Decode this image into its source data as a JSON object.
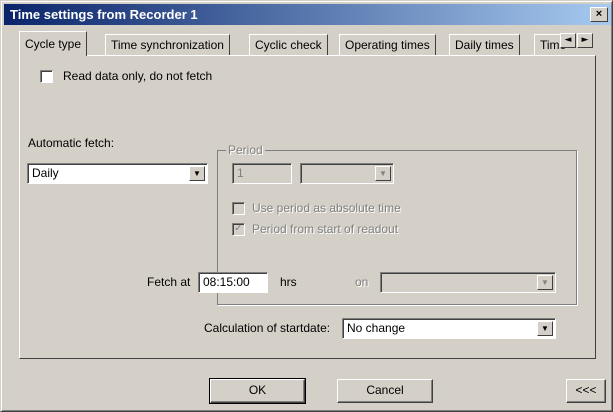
{
  "window": {
    "title": "Time settings from Recorder 1",
    "close_glyph": "×"
  },
  "tabs": [
    {
      "label": "Cycle type",
      "active": true
    },
    {
      "label": "Time synchronization"
    },
    {
      "label": "Cyclic check"
    },
    {
      "label": "Operating times"
    },
    {
      "label": "Daily times"
    },
    {
      "label": "Time"
    }
  ],
  "tab_scroll": {
    "left": "◄",
    "right": "►"
  },
  "read_only": {
    "label": "Read data only, do not fetch",
    "checked": false
  },
  "automatic_fetch": {
    "label": "Automatic fetch:",
    "value": "Daily"
  },
  "period": {
    "label": "Period",
    "count_value": "1",
    "unit_value": "",
    "absolute_time": {
      "label": "Use period as absolute time",
      "checked": false
    },
    "from_start": {
      "label": "Period from start of readout",
      "checked": true,
      "check_glyph": "✓"
    }
  },
  "fetch_at": {
    "label": "Fetch at",
    "value": "08:15:00",
    "unit": "hrs",
    "on_label": "on",
    "on_value": ""
  },
  "startdate": {
    "label": "Calculation of startdate:",
    "value": "No change"
  },
  "buttons": {
    "ok": "OK",
    "cancel": "Cancel",
    "more": "<<<"
  },
  "dropdown_glyph": "▼"
}
